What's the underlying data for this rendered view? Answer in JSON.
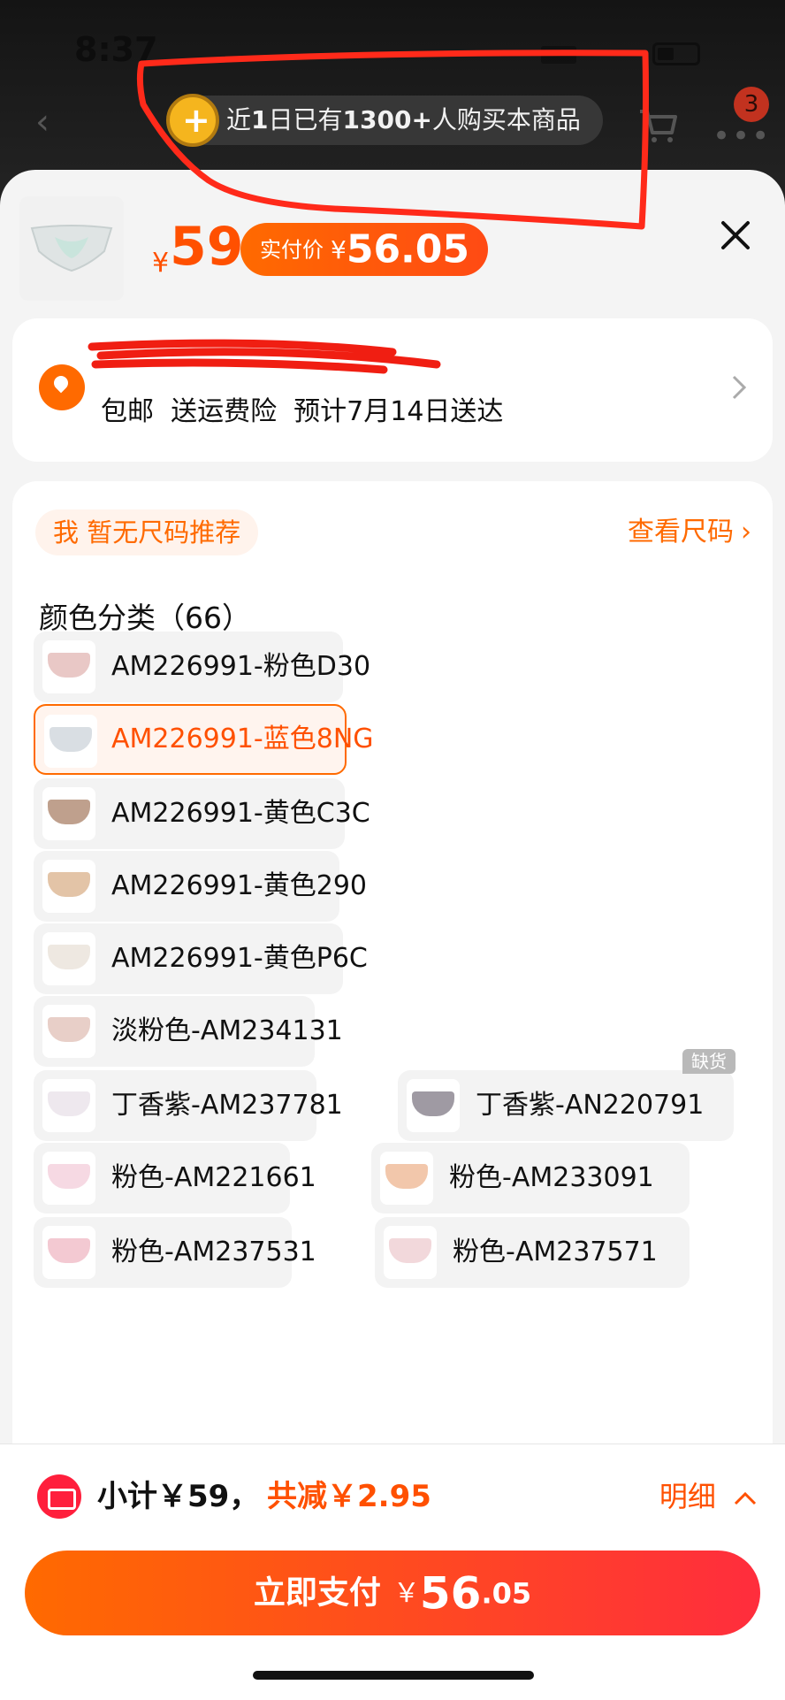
{
  "status": {
    "time": "8:37"
  },
  "nav": {
    "cart_badge": "3"
  },
  "promo": {
    "prefix": "近",
    "bold_1": "1",
    "mid": "日已有",
    "bold_2": "1300+",
    "suffix": "人购买本商品"
  },
  "product": {
    "yen": "¥",
    "price": "59",
    "paid_label": "实付价",
    "paid_yen": "¥",
    "paid_value": "56.05"
  },
  "address": {
    "delivery": "包邮  送运费险  预计7月14日送达"
  },
  "spec": {
    "no_size": "我 暂无尺码推荐",
    "size_link": "查看尺码",
    "color_title": "颜色分类（66）",
    "sold_out": "缺货",
    "options": [
      {
        "label": "AM226991-粉色D30",
        "thumb_color": "#e9c8c6"
      },
      {
        "label": "AM226991-蓝色8NG",
        "thumb_color": "#d9dee3"
      },
      {
        "label": "AM226991-黄色C3C",
        "thumb_color": "#bfa08d"
      },
      {
        "label": "AM226991-黄色290",
        "thumb_color": "#e3c4a7"
      },
      {
        "label": "AM226991-黄色P6C",
        "thumb_color": "#eee8e1"
      },
      {
        "label": "淡粉色-AM234131",
        "thumb_color": "#e8cfc8"
      },
      {
        "label": "丁香紫-AM237781",
        "thumb_color": "#eee8ee"
      },
      {
        "label": "丁香紫-AN220791",
        "thumb_color": "#9f9aa3"
      },
      {
        "label": "粉色-AM221661",
        "thumb_color": "#f6d9e3"
      },
      {
        "label": "粉色-AM233091",
        "thumb_color": "#f2c7ab"
      },
      {
        "label": "粉色-AM237531",
        "thumb_color": "#f3c9d2"
      },
      {
        "label": "粉色-AM237571",
        "thumb_color": "#f2d8db"
      }
    ]
  },
  "footer": {
    "subtotal": "小计￥59，",
    "discount": "共减￥2.95",
    "detail": "明细",
    "pay_label": "立即支付",
    "pay_yen": "￥",
    "pay_int": "56",
    "pay_dec": ".05"
  },
  "colors": {
    "accent": "#ff5000",
    "accent_light": "#fff3ec",
    "annotation": "#ff2a1a"
  }
}
